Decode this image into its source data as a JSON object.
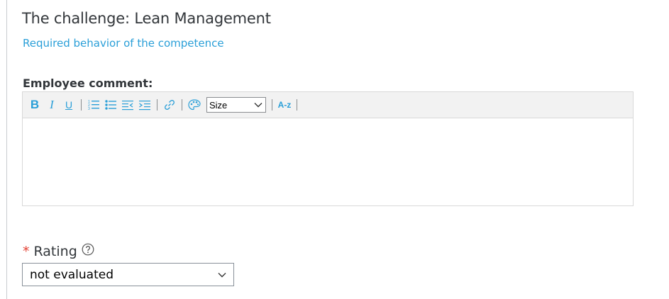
{
  "section": {
    "title": "The challenge: Lean Management",
    "behavior_link": "Required behavior of the competence"
  },
  "comment": {
    "label": "Employee comment:",
    "value": ""
  },
  "toolbar": {
    "bold": "B",
    "italic": "I",
    "underline": "U",
    "font_size_select": "Size",
    "az_button": "A-z",
    "icons": [
      "bold",
      "italic",
      "underline",
      "ordered-list-icon",
      "unordered-list-icon",
      "outdent-icon",
      "indent-icon",
      "link-icon",
      "color-palette-icon",
      "chevron-down-icon",
      "spell-check-icon"
    ],
    "accent_color": "#2a9fd8"
  },
  "rating": {
    "required_marker": "*",
    "label": "Rating",
    "selected": "not evaluated",
    "required_color": "#e34234"
  }
}
